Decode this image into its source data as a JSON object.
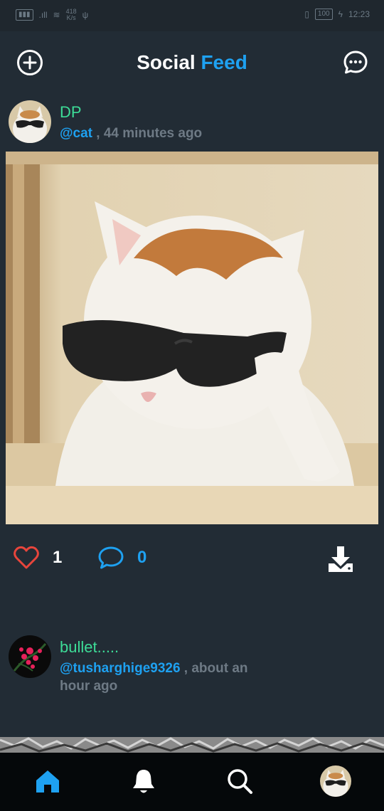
{
  "status_bar": {
    "speed_value": "418",
    "speed_unit": "K/s",
    "battery": "100",
    "time": "12:23"
  },
  "header": {
    "title_part1": "Social",
    "title_part2": "Feed",
    "accent_color": "#1ea1f1"
  },
  "posts": [
    {
      "username": "DP",
      "handle": "@cat",
      "time": " , 44 minutes ago",
      "likes": "1",
      "comments": "0"
    },
    {
      "username": "bullet.....",
      "handle": "@tusharghige9326",
      "time": " , about an hour ago"
    }
  ],
  "colors": {
    "background": "#222c35",
    "username": "#3ddc97",
    "like": "#e8453c",
    "comment": "#1ea1f1",
    "nav_active": "#1ea1f1"
  },
  "icons": {
    "header_left": "add-circle-icon",
    "header_right": "chat-bubble-icon",
    "like": "heart-icon",
    "comment": "comment-icon",
    "download": "download-icon",
    "nav": [
      "home-icon",
      "bell-icon",
      "search-icon",
      "profile-avatar"
    ]
  }
}
